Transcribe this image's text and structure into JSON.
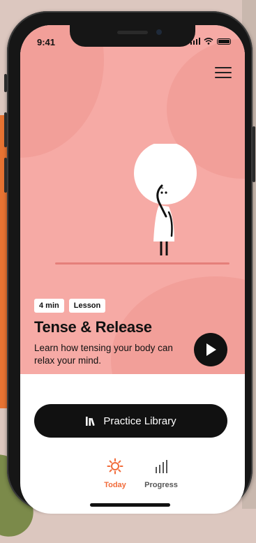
{
  "status_bar": {
    "time": "9:41"
  },
  "hero": {
    "badges": [
      "4 min",
      "Lesson"
    ],
    "title": "Tense & Release",
    "description": "Learn how tensing your body can relax your mind."
  },
  "library_button": {
    "label": "Practice Library"
  },
  "tabs": [
    {
      "label": "Today",
      "icon": "sun-icon",
      "active": true
    },
    {
      "label": "Progress",
      "icon": "bar-chart-icon",
      "active": false
    }
  ],
  "colors": {
    "hero_bg": "#f6aaa5",
    "accent": "#f16b3a",
    "dark": "#111111",
    "inactive_tab": "#555555"
  }
}
